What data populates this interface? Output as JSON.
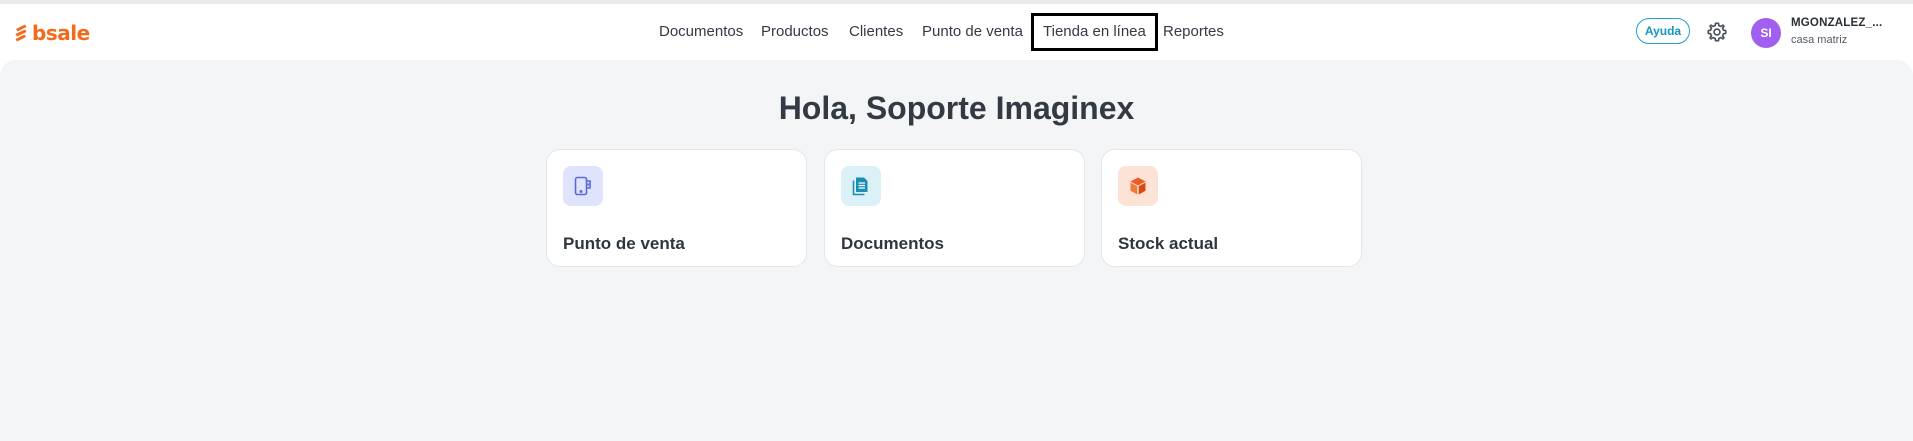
{
  "brand": {
    "name": "bsale",
    "color": "#f26b1d"
  },
  "nav": {
    "items": [
      {
        "label": "Documentos"
      },
      {
        "label": "Productos"
      },
      {
        "label": "Clientes"
      },
      {
        "label": "Punto de venta"
      },
      {
        "label": "Tienda en línea",
        "active": true
      },
      {
        "label": "Reportes"
      }
    ]
  },
  "header": {
    "help_label": "Ayuda",
    "settings_icon": "gear-icon",
    "user": {
      "initials": "SI",
      "name": "MGONZALEZ_...",
      "branch": "casa matriz"
    }
  },
  "main": {
    "greeting": "Hola, Soporte Imaginex",
    "cards": [
      {
        "label": "Punto de venta",
        "icon": "tablet-icon",
        "icon_bg": "#dfe3fb",
        "icon_color": "#5b6ad6"
      },
      {
        "label": "Documentos",
        "icon": "document-icon",
        "icon_bg": "#dcf1f7",
        "icon_color": "#1b8fb3"
      },
      {
        "label": "Stock actual",
        "icon": "box-icon",
        "icon_bg": "#fde3d6",
        "icon_color": "#ef5a1f"
      }
    ]
  }
}
